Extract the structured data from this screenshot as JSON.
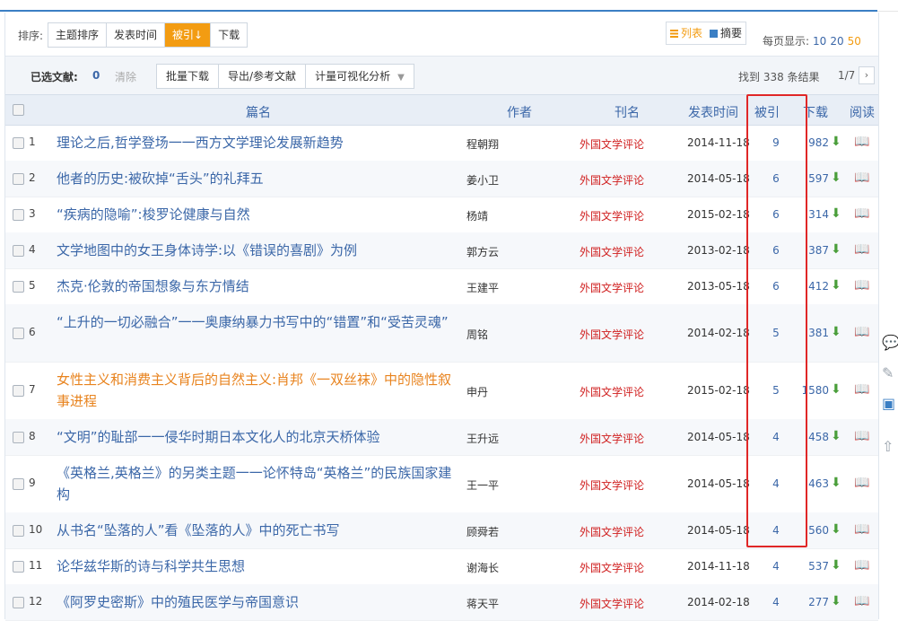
{
  "sortbar": {
    "label": "排序:",
    "buttons": [
      "主题排序",
      "发表时间",
      "被引",
      "下载"
    ],
    "active_index": 2,
    "active_suffix": "↓",
    "view": {
      "list": "列表",
      "abstract": "摘要"
    },
    "perpage_label": "每页显示:",
    "perpage_options": [
      "10",
      "20",
      "50"
    ],
    "perpage_active": "50"
  },
  "selbar": {
    "label": "已选文献:",
    "count": "0",
    "clear": "清除",
    "actions": [
      "批量下载",
      "导出/参考文献",
      "计量可视化分析"
    ],
    "found": "找到 338 条结果",
    "page": "1/7",
    "next": "›"
  },
  "table": {
    "headers": {
      "title": "篇名",
      "author": "作者",
      "journal": "刊名",
      "date": "发表时间",
      "cite": "被引",
      "download": "下载",
      "read": "阅读"
    },
    "rows": [
      {
        "n": "1",
        "title": "理论之后,哲学登场一一西方文学理论发展新趋势",
        "author": "程朝翔",
        "journal": "外国文学评论",
        "date": "2014-11-18",
        "cite": "9",
        "dl": "982"
      },
      {
        "n": "2",
        "title": "他者的历史:被砍掉“舌头”的礼拜五",
        "author": "姜小卫",
        "journal": "外国文学评论",
        "date": "2014-05-18",
        "cite": "6",
        "dl": "597"
      },
      {
        "n": "3",
        "title": "“疾病的隐喻”:梭罗论健康与自然",
        "author": "杨靖",
        "journal": "外国文学评论",
        "date": "2015-02-18",
        "cite": "6",
        "dl": "314"
      },
      {
        "n": "4",
        "title": "文学地图中的女王身体诗学:以《错误的喜剧》为例",
        "author": "郭方云",
        "journal": "外国文学评论",
        "date": "2013-02-18",
        "cite": "6",
        "dl": "387"
      },
      {
        "n": "5",
        "title": "杰克·伦敦的帝国想象与东方情结",
        "author": "王建平",
        "journal": "外国文学评论",
        "date": "2013-05-18",
        "cite": "6",
        "dl": "412"
      },
      {
        "n": "6",
        "title": "“上升的一切必融合”一一奥康纳暴力书写中的“错置”和“受苦灵魂”",
        "author": "周铭",
        "journal": "外国文学评论",
        "date": "2014-02-18",
        "cite": "5",
        "dl": "381"
      },
      {
        "n": "7",
        "title": "女性主义和消费主义背后的自然主义:肖邦《一双丝袜》中的隐性叙事进程",
        "author": "申丹",
        "journal": "外国文学评论",
        "date": "2015-02-18",
        "cite": "5",
        "dl": "1580"
      },
      {
        "n": "8",
        "title": "“文明”的耻部一一侵华时期日本文化人的北京天桥体验",
        "author": "王升远",
        "journal": "外国文学评论",
        "date": "2014-05-18",
        "cite": "4",
        "dl": "458"
      },
      {
        "n": "9",
        "title": "《英格兰,英格兰》的另类主题一一论怀特岛“英格兰”的民族国家建构",
        "author": "王一平",
        "journal": "外国文学评论",
        "date": "2014-05-18",
        "cite": "4",
        "dl": "463"
      },
      {
        "n": "10",
        "title": "从书名“坠落的人”看《坠落的人》中的死亡书写",
        "author": "顾舜若",
        "journal": "外国文学评论",
        "date": "2014-05-18",
        "cite": "4",
        "dl": "560"
      },
      {
        "n": "11",
        "title": "论华兹华斯的诗与科学共生思想",
        "author": "谢海长",
        "journal": "外国文学评论",
        "date": "2014-11-18",
        "cite": "4",
        "dl": "537"
      },
      {
        "n": "12",
        "title": "《阿罗史密斯》中的殖民医学与帝国意识",
        "author": "蒋天平",
        "journal": "外国文学评论",
        "date": "2014-02-18",
        "cite": "4",
        "dl": "277"
      }
    ]
  },
  "colors": {
    "accent": "#f39c12",
    "link": "#3b67a8",
    "journal": "#d02020",
    "highlight_box": "#e02727",
    "icon_green": "#4a9e3a"
  },
  "icons": {
    "download": "download-arrow-icon",
    "read": "open-book-icon",
    "sidebar": [
      "comment-icon",
      "edit-pen-icon",
      "note-icon",
      "back-to-top-icon"
    ]
  }
}
